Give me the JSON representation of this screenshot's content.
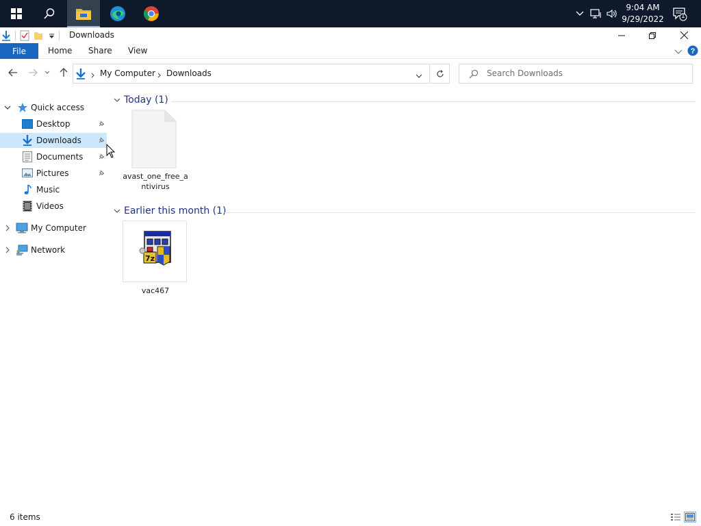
{
  "taskbar": {
    "clock_time": "9:04 AM",
    "clock_date": "9/29/2022",
    "notification_count": "1"
  },
  "window": {
    "title": "Downloads"
  },
  "ribbon": {
    "tabs": [
      "File",
      "Home",
      "Share",
      "View"
    ]
  },
  "address": {
    "crumbs": [
      "My Computer",
      "Downloads"
    ],
    "search_placeholder": "Search Downloads"
  },
  "nav": {
    "quick_access": "Quick access",
    "items": [
      {
        "label": "Desktop",
        "icon": "desktop-folder-icon"
      },
      {
        "label": "Downloads",
        "icon": "downloads-folder-icon"
      },
      {
        "label": "Documents",
        "icon": "documents-folder-icon"
      },
      {
        "label": "Pictures",
        "icon": "pictures-folder-icon"
      },
      {
        "label": "Music",
        "icon": "music-folder-icon"
      },
      {
        "label": "Videos",
        "icon": "videos-folder-icon"
      }
    ],
    "my_computer": "My Computer",
    "network": "Network"
  },
  "groups": [
    {
      "label": "Today (1)",
      "files": [
        {
          "name": "avast_one_free_antivirus",
          "icon": "blank-file-icon"
        }
      ]
    },
    {
      "label": "Earlier this month (1)",
      "files": [
        {
          "name": "vac467",
          "icon": "installer-7z-icon"
        }
      ]
    }
  ],
  "status": {
    "item_count": "6 items"
  },
  "colors": {
    "taskbar": "#0e1a2b",
    "file_tab": "#1a67c2",
    "selection": "#cce8ff",
    "group_header": "#1e3287"
  }
}
